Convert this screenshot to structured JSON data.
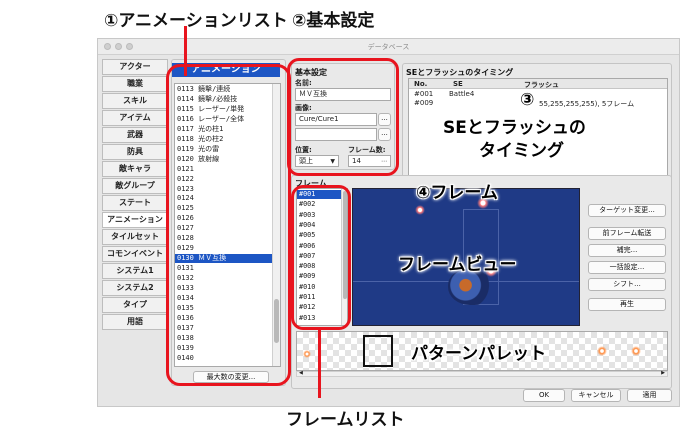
{
  "callouts": {
    "anim_list": "①アニメーションリスト",
    "basic": "②基本設定",
    "se_num": "③",
    "se_label_1": "SEとフラッシュの",
    "se_label_2": "タイミング",
    "frame": "④フレーム",
    "frame_view": "フレームビュー",
    "pattern_palette": "パターンパレット",
    "frame_list": "フレームリスト"
  },
  "window": {
    "title": "データベース"
  },
  "sidebar": {
    "items": [
      {
        "label": "アクター"
      },
      {
        "label": "職業"
      },
      {
        "label": "スキル"
      },
      {
        "label": "アイテム"
      },
      {
        "label": "武器"
      },
      {
        "label": "防具"
      },
      {
        "label": "敵キャラ"
      },
      {
        "label": "敵グループ"
      },
      {
        "label": "ステート"
      },
      {
        "label": "アニメーション"
      },
      {
        "label": "タイルセット"
      },
      {
        "label": "コモンイベント"
      },
      {
        "label": "システム1"
      },
      {
        "label": "システム2"
      },
      {
        "label": "タイプ"
      },
      {
        "label": "用語"
      }
    ]
  },
  "anim_list": {
    "header": "アニメーション",
    "rows": [
      "0113 鏡擊/連続",
      "0114 鏡擊/必殺技",
      "0115 レーザー/単発",
      "0116 レーザー/全体",
      "0117 光の柱1",
      "0118 光の柱2",
      "0119 光の雷",
      "0120 放射線",
      "0121",
      "0122",
      "0123",
      "0124",
      "0125",
      "0126",
      "0127",
      "0128",
      "0129",
      "0130 ＭＶ互換",
      "0131",
      "0132",
      "0133",
      "0134",
      "0135",
      "0136",
      "0137",
      "0138",
      "0139",
      "0140"
    ],
    "selected_row": "0130 ＭＶ互換",
    "max_button": "最大数の変更..."
  },
  "basic": {
    "title": "基本設定",
    "name_label": "名前:",
    "name_value": "ＭＶ互換",
    "image_label": "画像:",
    "image1_value": "Cure/Cure1",
    "image2_value": "",
    "browse_label": "...",
    "position_label": "位置:",
    "position_value": "頭上",
    "frames_label": "フレーム数:",
    "frames_value": "14"
  },
  "se": {
    "title": "SEとフラッシュのタイミング",
    "columns": [
      "No.",
      "SE",
      "フラッシュ"
    ],
    "rows": [
      {
        "no": "#001",
        "se": "Battle4",
        "flash": ""
      },
      {
        "no": "#009",
        "se": "",
        "flash": "55,255,255,255), 5フレーム"
      }
    ]
  },
  "frames": {
    "title": "フレーム",
    "rows": [
      "#001",
      "#002",
      "#003",
      "#004",
      "#005",
      "#006",
      "#007",
      "#008",
      "#009",
      "#010",
      "#011",
      "#012",
      "#013"
    ],
    "selected": "#001",
    "buttons": {
      "target": "ターゲット変更...",
      "prev": "前フレーム転送",
      "tween": "補完...",
      "batch": "一括設定...",
      "shift": "シフト...",
      "play": "再生"
    }
  },
  "footer": {
    "ok": "OK",
    "cancel": "キャンセル",
    "apply": "適用"
  },
  "colors": {
    "accent": "#1d56c4",
    "callout_red": "#e8141e",
    "preview_bg": "#1f3a86"
  }
}
